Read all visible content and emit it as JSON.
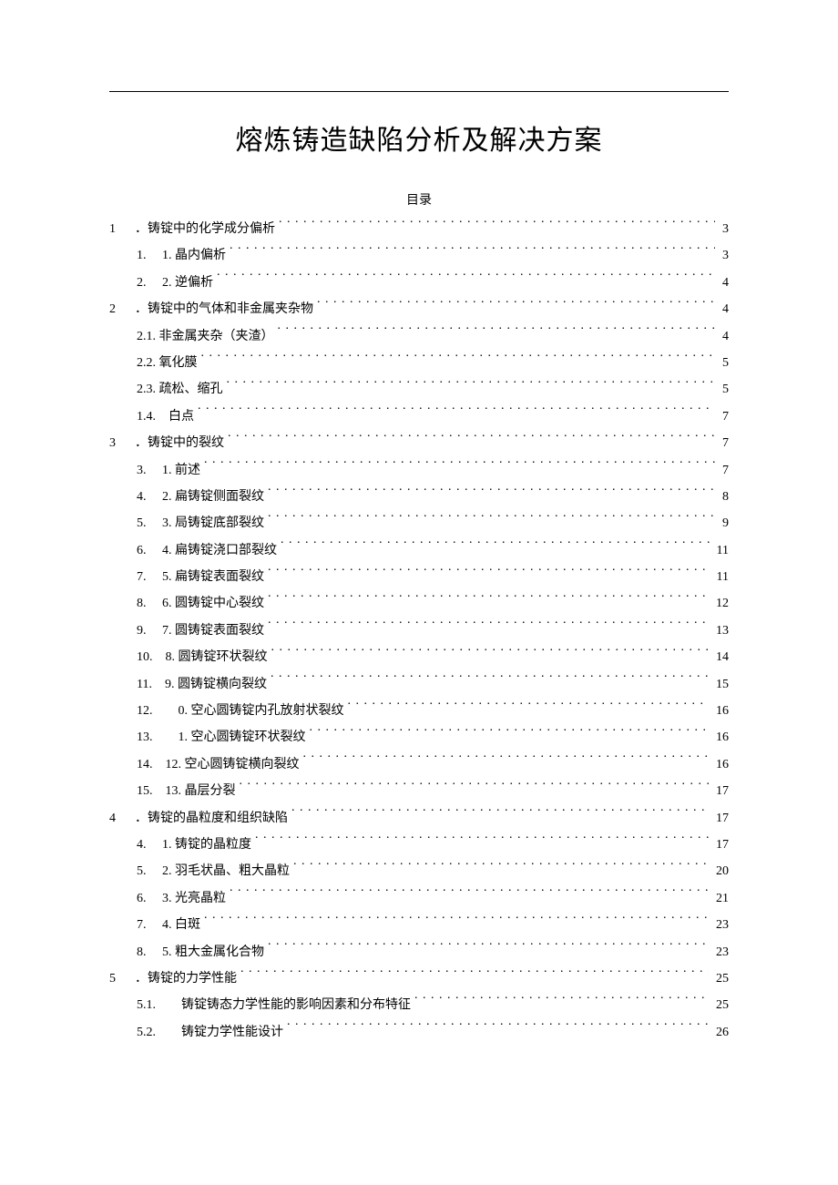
{
  "title": "熔炼铸造缺陷分析及解决方案",
  "toc_header": "目录",
  "entries": [
    {
      "level": 1,
      "num": "1",
      "label": "．铸锭中的化学成分偏析",
      "page": "3"
    },
    {
      "level": 2,
      "num": "1.",
      "label": "1. 晶内偏析",
      "page": "3"
    },
    {
      "level": 2,
      "num": "2.",
      "label": "2. 逆偏析",
      "page": "4"
    },
    {
      "level": 1,
      "num": "2",
      "label": "．铸锭中的气体和非金属夹杂物",
      "page": "4"
    },
    {
      "level": 2,
      "num": "",
      "label": "2.1. 非金属夹杂（夹渣）",
      "page": "4"
    },
    {
      "level": 2,
      "num": "",
      "label": "2.2. 氧化膜",
      "page": "5"
    },
    {
      "level": 2,
      "num": "",
      "label": "2.3. 疏松、缩孔",
      "page": "5"
    },
    {
      "level": 2,
      "num": "",
      "label": "1.4.　白点",
      "page": "7"
    },
    {
      "level": 1,
      "num": "3",
      "label": "．铸锭中的裂纹",
      "page": "7"
    },
    {
      "level": 2,
      "num": "3.",
      "label": "1. 前述",
      "page": "7"
    },
    {
      "level": 2,
      "num": "4.",
      "label": "2. 扁铸锭侧面裂纹",
      "page": "8"
    },
    {
      "level": 2,
      "num": "5.",
      "label": "3. 局铸锭底部裂纹",
      "page": "9"
    },
    {
      "level": 2,
      "num": "6.",
      "label": "4. 扁铸锭浇口部裂纹",
      "page": "11"
    },
    {
      "level": 2,
      "num": "7.",
      "label": "5. 扁铸锭表面裂纹",
      "page": "11"
    },
    {
      "level": 2,
      "num": "8.",
      "label": "6. 圆铸锭中心裂纹",
      "page": "12"
    },
    {
      "level": 2,
      "num": "9.",
      "label": "7. 圆铸锭表面裂纹",
      "page": "13"
    },
    {
      "level": 2,
      "num": "10.",
      "label": "8. 圆铸锭环状裂纹",
      "page": "14"
    },
    {
      "level": 2,
      "num": "11.",
      "label": "9. 圆铸锭横向裂纹",
      "page": "15"
    },
    {
      "level": 2,
      "num": "12.",
      "label": "　0. 空心圆铸锭内孔放射状裂纹",
      "page": "16"
    },
    {
      "level": 2,
      "num": "13.",
      "label": "　1. 空心圆铸锭环状裂纹",
      "page": "16"
    },
    {
      "level": 2,
      "num": "14.",
      "label": "12. 空心圆铸锭横向裂纹",
      "page": "16"
    },
    {
      "level": 2,
      "num": "15.",
      "label": "13. 晶层分裂",
      "page": "17"
    },
    {
      "level": 1,
      "num": "4",
      "label": "．铸锭的晶粒度和组织缺陷",
      "page": "17"
    },
    {
      "level": 2,
      "num": "4.",
      "label": "1. 铸锭的晶粒度",
      "page": "17"
    },
    {
      "level": 2,
      "num": "5.",
      "label": "2. 羽毛状晶、粗大晶粒",
      "page": "20"
    },
    {
      "level": 2,
      "num": "6.",
      "label": "3. 光亮晶粒",
      "page": "21"
    },
    {
      "level": 2,
      "num": "7.",
      "label": "4. 白斑",
      "page": "23"
    },
    {
      "level": 2,
      "num": "8.",
      "label": "5. 粗大金属化合物",
      "page": "23"
    },
    {
      "level": 1,
      "num": "5",
      "label": "．铸锭的力学性能",
      "page": "25"
    },
    {
      "level": 2,
      "num": "5.1.",
      "label": "　铸锭铸态力学性能的影响因素和分布特征",
      "page": "25"
    },
    {
      "level": 2,
      "num": "5.2.",
      "label": "　铸锭力学性能设计",
      "page": "26"
    }
  ]
}
